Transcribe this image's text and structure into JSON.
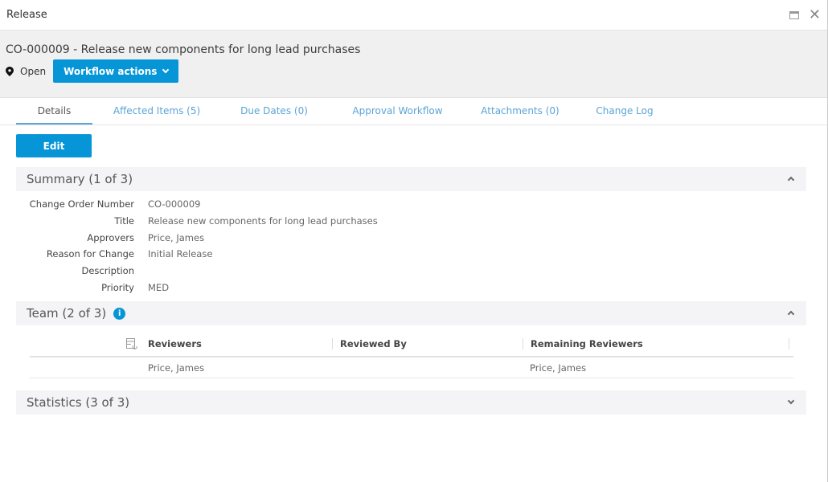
{
  "window": {
    "title": "Release",
    "maximize_icon": "maximize-icon",
    "close_icon": "close-icon"
  },
  "header": {
    "change_order_title": "CO-000009 - Release new components for long lead purchases",
    "status_icon": "map-pin-icon",
    "status": "Open",
    "workflow_button": "Workflow actions"
  },
  "tabs": [
    {
      "label": "Details",
      "active": true
    },
    {
      "label": "Affected Items (5)"
    },
    {
      "label": "Due Dates (0)"
    },
    {
      "label": "Approval Workflow"
    },
    {
      "label": "Attachments (0)"
    },
    {
      "label": "Change Log"
    }
  ],
  "edit_button": "Edit",
  "summary": {
    "title": "Summary (1 of 3)",
    "fields": [
      {
        "label": "Change Order Number",
        "value": "CO-000009"
      },
      {
        "label": "Title",
        "value": "Release new components for long lead purchases"
      },
      {
        "label": "Approvers",
        "value": "Price, James"
      },
      {
        "label": "Reason for Change",
        "value": "Initial Release"
      },
      {
        "label": "Description",
        "value": ""
      },
      {
        "label": "Priority",
        "value": "MED"
      }
    ]
  },
  "team": {
    "title": "Team (2 of 3)",
    "columns": [
      "Reviewers",
      "Reviewed By",
      "Remaining Reviewers"
    ],
    "rows": [
      {
        "reviewers": "Price, James",
        "reviewed_by": "",
        "remaining_reviewers": "Price, James"
      }
    ]
  },
  "statistics": {
    "title": "Statistics (3 of 3)"
  },
  "colors": {
    "accent": "#0696d7",
    "tab_link": "#5aa4d8",
    "section_bg": "#f4f4f6"
  }
}
